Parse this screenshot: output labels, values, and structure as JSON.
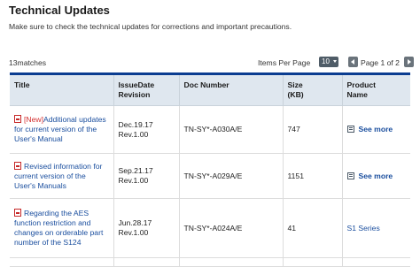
{
  "header": {
    "title": "Technical Updates",
    "subtitle": "Make sure to check the technical updates for corrections and important precautions."
  },
  "toolbar": {
    "matches": "13matches",
    "items_per_page_label": "Items Per Page",
    "items_per_page_value": "10",
    "page_indicator": "Page 1 of 2"
  },
  "table": {
    "columns": [
      "Title",
      "IssueDate Revision",
      "Doc Number",
      "Size (KB)",
      "Product Name"
    ],
    "column_lines": {
      "issuedate_1": "IssueDate",
      "issuedate_2": "Revision",
      "size_1": "Size",
      "size_2": "(KB)",
      "product_1": "Product",
      "product_2": "Name"
    },
    "rows": [
      {
        "new_tag": "[New]",
        "title": "Additional updates for current version of the User's Manual",
        "date": "Dec.19.17",
        "revision": "Rev.1.00",
        "doc_number": "TN-SY*-A030A/E",
        "size": "747",
        "product": "See more"
      },
      {
        "title": "Revised information for current version of the User's Manuals",
        "date": "Sep.21.17",
        "revision": "Rev.1.00",
        "doc_number": "TN-SY*-A029A/E",
        "size": "1151",
        "product": "See more"
      },
      {
        "title": "Regarding the AES function restriction and changes on orderable part number of the S124",
        "date": "Jun.28.17",
        "revision": "Rev.1.00",
        "doc_number": "TN-SY*-A024A/E",
        "size": "41",
        "product": "S1 Series"
      }
    ]
  },
  "colors": {
    "header_bg": "#dfe7ef",
    "header_accent": "#0b3d91",
    "link": "#1a4e9e",
    "new_tag": "#d32f2f",
    "select_bg": "#4f5c67"
  }
}
